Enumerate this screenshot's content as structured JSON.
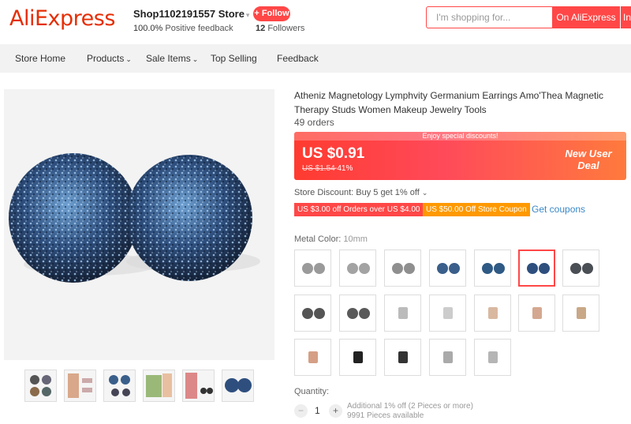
{
  "header": {
    "logo": "AliExpress",
    "store_name": "Shop1102191557 Store",
    "feedback_pct": "100.0%",
    "feedback_label": "Positive feedback",
    "follow_label": "+ Follow",
    "followers_count": "12",
    "followers_label": "Followers",
    "search_placeholder": "I'm shopping for...",
    "search_button": "On AliExpress",
    "search_button2": "In"
  },
  "nav": {
    "items": [
      "Store Home",
      "Products",
      "Sale Items",
      "Top Selling",
      "Feedback"
    ]
  },
  "product": {
    "title": "Atheniz Magnetology Lymphvity Germanium Earrings Amo'Thea Magnetic Therapy Studs Women Makeup Jewelry Tools",
    "orders": "49 orders",
    "discount_strip": "Enjoy special discounts!",
    "price": "US $0.91",
    "old_price": "US $1.54",
    "discount_pct": "-41%",
    "new_user_deal": "New User Deal",
    "store_discount": "Store Discount: Buy 5 get 1% off",
    "coupon1": "US $3.00 off Orders over US $4.00",
    "coupon2": "US $50.00 Off Store Coupon",
    "get_coupons": "Get coupons",
    "metal_color_label": "Metal Color:",
    "metal_color_value": "10mm",
    "quantity_label": "Quantity:",
    "quantity_value": "1",
    "quantity_note1": "Additional 1% off (2 Pieces or more)",
    "quantity_note2": "9991 Pieces available"
  },
  "colors": {
    "brand": "#e62e04",
    "accent": "#ff4747",
    "coupon_orange": "#ff9900",
    "link": "#3a88c8"
  }
}
